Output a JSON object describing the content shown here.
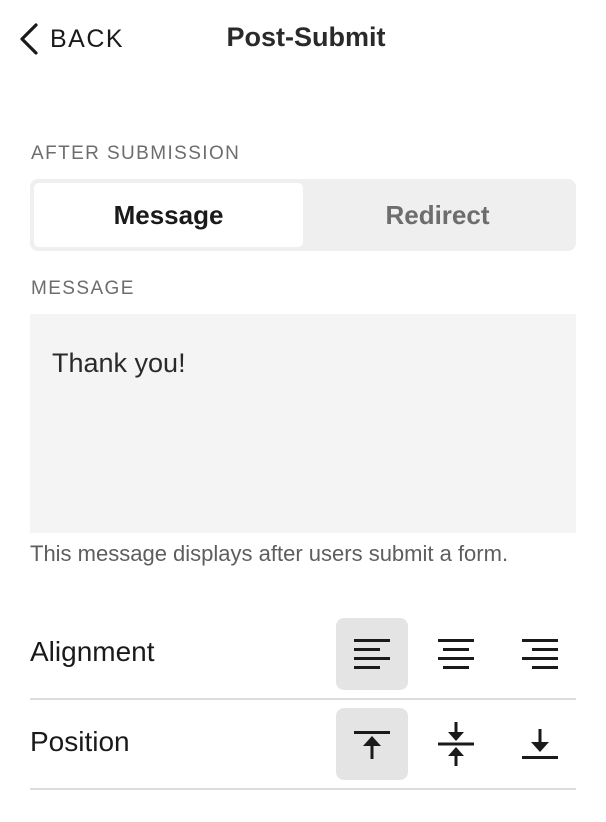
{
  "header": {
    "back_label": "BACK",
    "title": "Post-Submit"
  },
  "after_submission": {
    "label": "AFTER SUBMISSION",
    "options": [
      "Message",
      "Redirect"
    ],
    "selected": "Message"
  },
  "message": {
    "label": "MESSAGE",
    "value": "Thank you!",
    "help_text": "This message displays after users submit a form."
  },
  "alignment": {
    "label": "Alignment",
    "options": [
      "left-align-icon",
      "center-align-icon",
      "right-align-icon"
    ],
    "selected": "left"
  },
  "position": {
    "label": "Position",
    "options": [
      "align-top-icon",
      "align-middle-icon",
      "align-bottom-icon"
    ],
    "selected": "top"
  },
  "colors": {
    "selected_bg": "#e4e4e4",
    "field_bg": "#f4f4f4",
    "segment_bg": "#efefef",
    "divider": "#dcdcdc"
  }
}
